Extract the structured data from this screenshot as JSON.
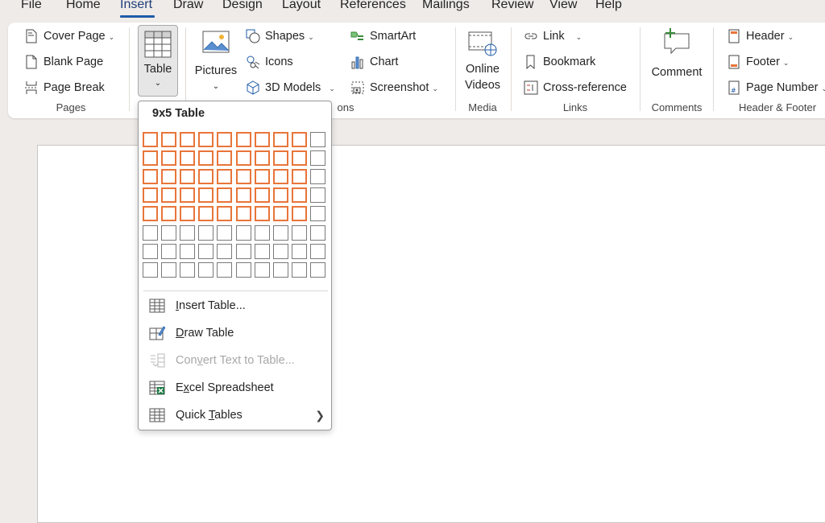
{
  "menu": [
    {
      "label": "File"
    },
    {
      "label": "Home"
    },
    {
      "label": "Insert"
    },
    {
      "label": "Draw"
    },
    {
      "label": "Design"
    },
    {
      "label": "Layout"
    },
    {
      "label": "References"
    },
    {
      "label": "Mailings"
    },
    {
      "label": "Review"
    },
    {
      "label": "View"
    },
    {
      "label": "Help"
    }
  ],
  "ribbon": {
    "pages": {
      "cover": "Cover Page",
      "blank": "Blank Page",
      "break": "Page Break",
      "group": "Pages"
    },
    "table": {
      "label": "Table"
    },
    "illustrations": {
      "pictures": "Pictures",
      "shapes": "Shapes",
      "icons": "Icons",
      "models": "3D Models",
      "smartart": "SmartArt",
      "chart": "Chart",
      "screenshot": "Screenshot",
      "group_tail": "ons"
    },
    "media": {
      "line1": "Online",
      "line2": "Videos",
      "group": "Media"
    },
    "links": {
      "link": "Link",
      "bookmark": "Bookmark",
      "crossref": "Cross-reference",
      "group": "Links"
    },
    "comments": {
      "comment": "Comment",
      "group": "Comments"
    },
    "header_footer": {
      "header": "Header",
      "footer": "Footer",
      "page_number": "Page Number",
      "group": "Header & Footer"
    }
  },
  "dropdown": {
    "title": "9x5 Table",
    "grid": {
      "columns": 10,
      "rows": 8,
      "selected_columns": 9,
      "selected_rows": 5
    },
    "items": [
      {
        "pre": "",
        "u": "I",
        "post": "nsert Table..."
      },
      {
        "pre": "",
        "u": "D",
        "post": "raw Table"
      },
      {
        "pre": "Con",
        "u": "v",
        "post": "ert Text to Table..."
      },
      {
        "pre": "E",
        "u": "x",
        "post": "cel Spreadsheet"
      },
      {
        "pre": "Quick ",
        "u": "T",
        "post": "ables"
      }
    ]
  },
  "colors": {
    "selection": "#e8753a",
    "accent": "#1f5ba8",
    "excel": "#1d7a45"
  }
}
